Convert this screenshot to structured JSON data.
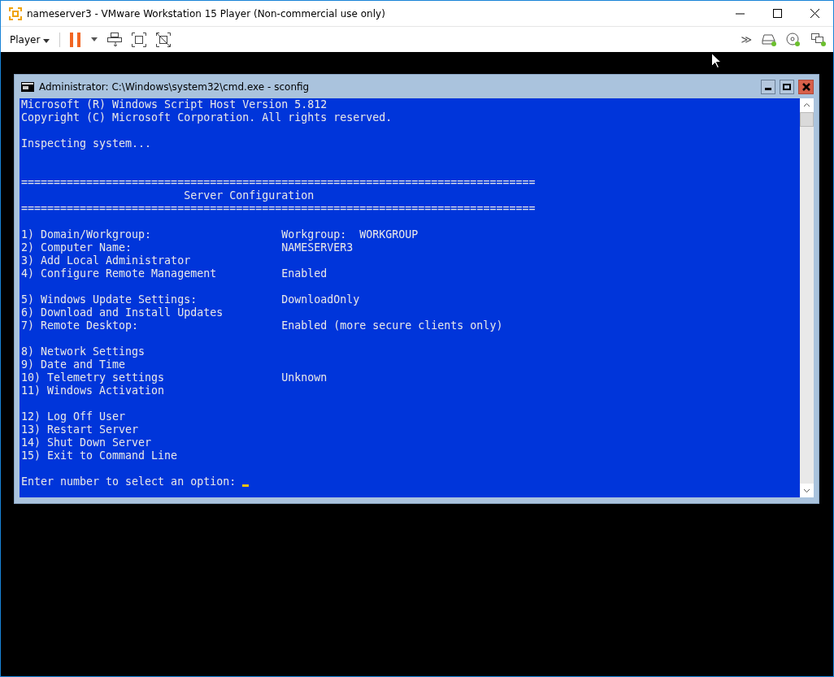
{
  "window": {
    "title": "nameserver3 - VMware Workstation 15 Player (Non-commercial use only)"
  },
  "toolbar": {
    "menu_label": "Player",
    "overflow": "≫"
  },
  "console": {
    "title": "Administrator: C:\\Windows\\system32\\cmd.exe - sconfig",
    "lines": [
      {
        "kind": "text",
        "text": "Microsoft (R) Windows Script Host Version 5.812"
      },
      {
        "kind": "text",
        "text": "Copyright (C) Microsoft Corporation. All rights reserved."
      },
      {
        "kind": "blank"
      },
      {
        "kind": "text",
        "text": "Inspecting system..."
      },
      {
        "kind": "blank"
      },
      {
        "kind": "blank"
      },
      {
        "kind": "rule",
        "text": "==============================================================================="
      },
      {
        "kind": "heading",
        "text": "Server Configuration"
      },
      {
        "kind": "rule",
        "text": "==============================================================================="
      },
      {
        "kind": "blank"
      },
      {
        "kind": "option",
        "label": "1) Domain/Workgroup:",
        "value": "Workgroup:  WORKGROUP"
      },
      {
        "kind": "option",
        "label": "2) Computer Name:",
        "value": "NAMESERVER3"
      },
      {
        "kind": "option",
        "label": "3) Add Local Administrator"
      },
      {
        "kind": "option",
        "label": "4) Configure Remote Management",
        "value": "Enabled"
      },
      {
        "kind": "blank"
      },
      {
        "kind": "option",
        "label": "5) Windows Update Settings:",
        "value": "DownloadOnly"
      },
      {
        "kind": "option",
        "label": "6) Download and Install Updates"
      },
      {
        "kind": "option",
        "label": "7) Remote Desktop:",
        "value": "Enabled (more secure clients only)"
      },
      {
        "kind": "blank"
      },
      {
        "kind": "option",
        "label": "8) Network Settings"
      },
      {
        "kind": "option",
        "label": "9) Date and Time"
      },
      {
        "kind": "option",
        "label": "10) Telemetry settings",
        "value": "Unknown"
      },
      {
        "kind": "option",
        "label": "11) Windows Activation"
      },
      {
        "kind": "blank"
      },
      {
        "kind": "option",
        "label": "12) Log Off User"
      },
      {
        "kind": "option",
        "label": "13) Restart Server"
      },
      {
        "kind": "option",
        "label": "14) Shut Down Server"
      },
      {
        "kind": "option",
        "label": "15) Exit to Command Line"
      },
      {
        "kind": "blank"
      },
      {
        "kind": "prompt",
        "text": "Enter number to select an option:"
      }
    ]
  }
}
